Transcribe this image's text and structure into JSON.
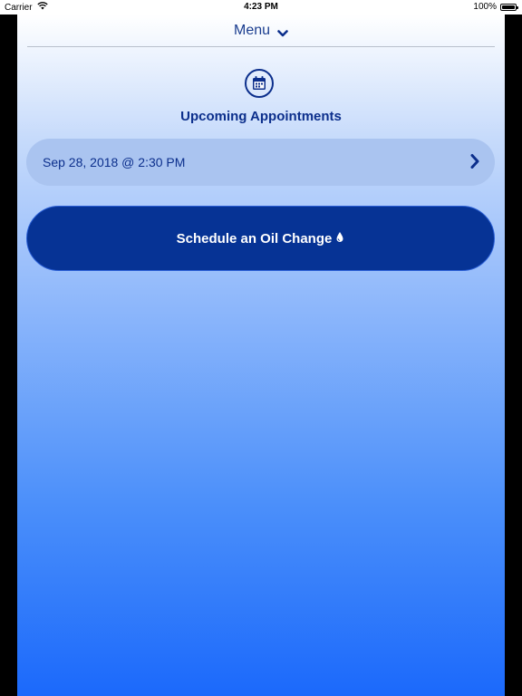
{
  "status_bar": {
    "carrier": "Carrier",
    "time": "4:23 PM",
    "battery": "100%",
    "battery_level": 1.0
  },
  "header": {
    "menu_label": "Menu",
    "menu_icon": "chevron-down-icon"
  },
  "appointments": {
    "icon": "calendar-icon",
    "title": "Upcoming Appointments",
    "items": [
      {
        "label": "Sep 28, 2018 @ 2:30 PM",
        "icon": "chevron-right-icon"
      }
    ]
  },
  "cta": {
    "label": "Schedule an Oil Change",
    "icon": "oil-drop-icon"
  },
  "colors": {
    "primary": "#063395",
    "text_accent": "#0c2f8c",
    "row_background": "#aac4f0",
    "gradient_top": "#ffffff",
    "gradient_bottom": "#1b69fb"
  }
}
